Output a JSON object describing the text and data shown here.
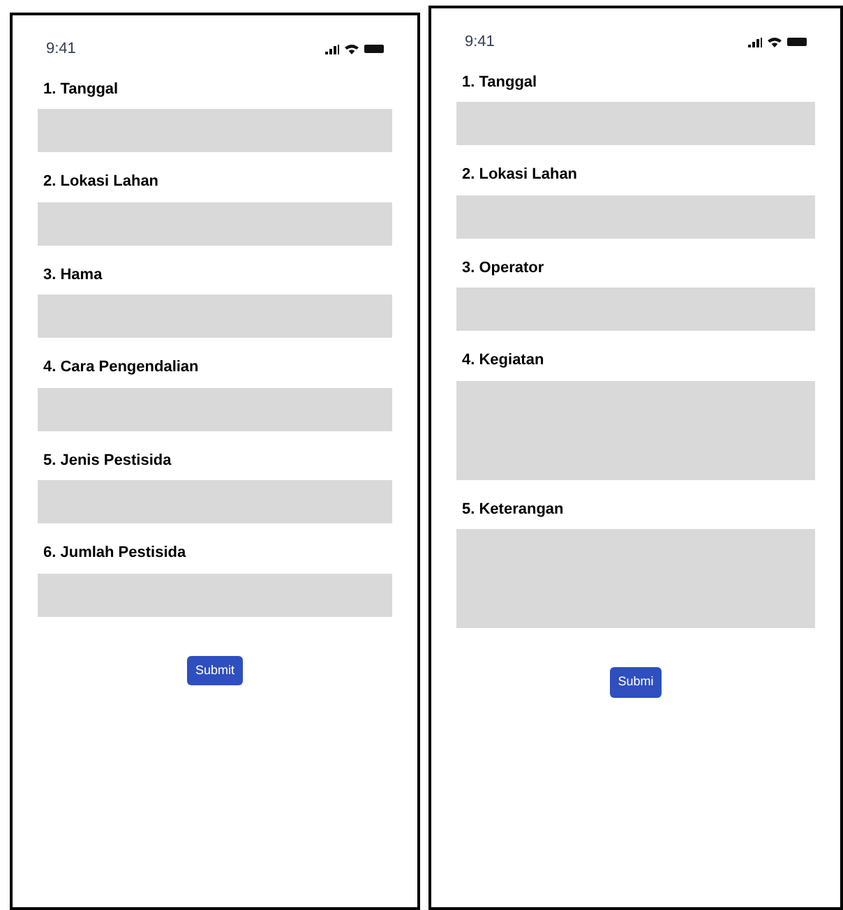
{
  "screens": [
    {
      "time": "9:41",
      "fields": [
        {
          "label": "1. Tanggal",
          "kind": "line"
        },
        {
          "label": "2. Lokasi Lahan",
          "kind": "line"
        },
        {
          "label": "3. Hama",
          "kind": "line"
        },
        {
          "label": "4. Cara Pengendalian",
          "kind": "line"
        },
        {
          "label": "5. Jenis Pestisida",
          "kind": "line"
        },
        {
          "label": "6. Jumlah Pestisida",
          "kind": "line"
        }
      ],
      "button": "Submit"
    },
    {
      "time": "9:41",
      "fields": [
        {
          "label": "1. Tanggal",
          "kind": "line"
        },
        {
          "label": "2. Lokasi Lahan",
          "kind": "line"
        },
        {
          "label": "3. Operator",
          "kind": "line"
        },
        {
          "label": "4. Kegiatan",
          "kind": "area"
        },
        {
          "label": "5. Keterangan",
          "kind": "area"
        }
      ],
      "button": "Submi"
    }
  ]
}
